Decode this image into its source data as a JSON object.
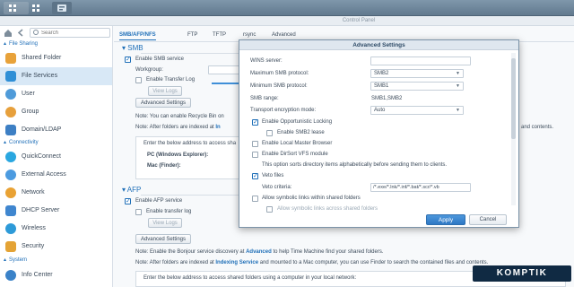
{
  "window": {
    "title": "Control Panel"
  },
  "sidebar": {
    "search_placeholder": "Search",
    "sections": [
      {
        "label": "File Sharing"
      },
      {
        "label": "Connectivity"
      },
      {
        "label": "System"
      }
    ],
    "items": [
      {
        "label": "Shared Folder",
        "icon": "folder-icon",
        "color": "#e8a23a"
      },
      {
        "label": "File Services",
        "icon": "file-services-icon",
        "color": "#2f8fd6"
      },
      {
        "label": "User",
        "icon": "user-icon",
        "color": "#4f9bd9"
      },
      {
        "label": "Group",
        "icon": "group-icon",
        "color": "#e7a03c"
      },
      {
        "label": "Domain/LDAP",
        "icon": "domain-icon",
        "color": "#3d7fc4"
      },
      {
        "label": "QuickConnect",
        "icon": "quickconnect-icon",
        "color": "#2aa7e0"
      },
      {
        "label": "External Access",
        "icon": "globe-icon",
        "color": "#4c9be0"
      },
      {
        "label": "Network",
        "icon": "network-icon",
        "color": "#e9a234"
      },
      {
        "label": "DHCP Server",
        "icon": "dhcp-icon",
        "color": "#3f86cf"
      },
      {
        "label": "Wireless",
        "icon": "wireless-icon",
        "color": "#2d9ad8"
      },
      {
        "label": "Security",
        "icon": "shield-icon",
        "color": "#e4a335"
      },
      {
        "label": "Info Center",
        "icon": "info-icon",
        "color": "#3a82c8"
      }
    ]
  },
  "tabs": [
    "SMB/AFP/NFS",
    "FTP",
    "TFTP",
    "rsync",
    "Advanced"
  ],
  "smb": {
    "title": "SMB",
    "enable_label": "Enable SMB service",
    "workgroup_label": "Workgroup:",
    "transfer_log_label": "Enable Transfer Log",
    "view_logs": "View Logs",
    "advanced_settings": "Advanced Settings",
    "note1": "Note: You can enable Recycle Bin on",
    "note2_prefix": "Note: After folders are indexed at",
    "note2_link": "In",
    "note2_suffix": "and contents.",
    "info_line": "Enter the below address to access sha",
    "pc_label": "PC (Windows Explorer):",
    "mac_label": "Mac (Finder):"
  },
  "afp": {
    "title": "AFP",
    "enable_label": "Enable AFP service",
    "transfer_log_label": "Enable transfer log",
    "view_logs": "View Logs",
    "advanced_settings": "Advanced Settings",
    "note1_prefix": "Note: Enable the Bonjour service discovery at",
    "note1_link": "Advanced",
    "note1_suffix": "to help Time Machine find your shared folders.",
    "note2_prefix": "Note: After folders are indexed at",
    "note2_link": "Indexing Service",
    "note2_suffix": "and mounted to a Mac computer, you can use Finder to search the contained files and contents.",
    "info_line": "Enter the below address to access shared folders using a computer in your local network:"
  },
  "dialog": {
    "title": "Advanced Settings",
    "wins_label": "WINS server:",
    "max_proto_label": "Maximum SMB protocol:",
    "max_proto_value": "SMB2",
    "min_proto_label": "Minimum SMB protocol:",
    "min_proto_value": "SMB1",
    "range_label": "SMB range:",
    "range_value": "SMB1,SMB2",
    "enc_label": "Transport encryption mode:",
    "enc_value": "Auto",
    "oplock_label": "Enable Opportunistic Locking",
    "smb2lease_label": "Enable SMB2 lease",
    "local_master_label": "Enable Local Master Browser",
    "dirsort_label": "Enable DirSort VFS module",
    "dirsort_note": "This option sorts directory items alphabetically before sending them to clients.",
    "veto_label": "Veto files",
    "veto_criteria_label": "Veto criteria:",
    "veto_criteria_value": "/*.exe/*.lnk/*.inf/*.bat/*.scr/*.vb",
    "symlink_label": "Allow symbolic links within shared folders",
    "symlink_across_label": "Allow symbolic links across shared folders",
    "apply": "Apply",
    "cancel": "Cancel"
  },
  "watermark": "KOMPTIK"
}
